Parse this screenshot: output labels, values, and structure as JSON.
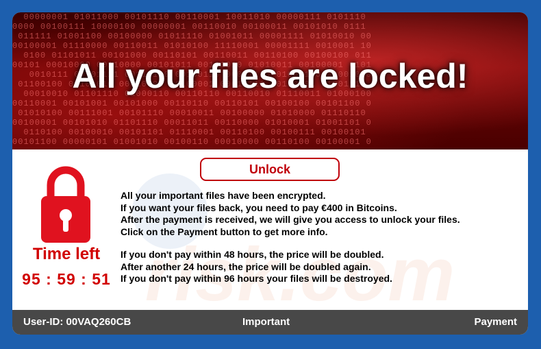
{
  "banner": {
    "title": "All your files are locked!",
    "background_binary": [
      "  00000001 01011000 00101110 00110001 10011010 00000111 0101110",
      "0000 00100111 10000100 00000001 00110010 00100011 00101010 0111",
      " 011111 01001100 00100000 01011110 01001011 00001111 01010010 00",
      "00100001 01110000 00110011 01010100 11110001 00001111 0010001 10",
      "  0100 01101011 00101000 00110101 00110011 00110100 00100100 011",
      "00101 00010000 00110000 00101011 00111010 01010011 00100001 0101",
      "   0010111 00101111 00110110 00100110 00001110 01001100 00001000",
      " 01100100 00101010 00010000 00100001 00010111 00110101 01001111 ",
      "  00010010 01101110 01000110 00110110 00110010 01110011 01000100",
      "00110001 00101001 00101000 00110110 00110101 00100100 00101100 0",
      " 01010100 00111001 00101110 00010011 00100000 01010000 01110110 ",
      "00100001 00101010 01101110 00011011 00110000 01010001 01001101 0",
      "  0110100 00100010 00101101 01110001 00110100 00100111 00100101 ",
      "00101100 00000101 01001010 00100110 00010000 00110100 00100001 0"
    ]
  },
  "watermark": {
    "text": "risk.com"
  },
  "lock_icon": {
    "name": "padlock-icon",
    "color": "#e0121f"
  },
  "timer": {
    "label": "Time left",
    "value": "95 : 59 : 51"
  },
  "unlock_button": {
    "label": "Unlock"
  },
  "message": {
    "lines": [
      "All your important files have been encrypted.",
      "If you want your files back, you need to pay €400 in Bitcoins.",
      "After the payment is received, we will give you access to unlock your files.",
      "Click on the Payment button to get more info.",
      "If you don't pay within 48 hours, the price will be doubled.",
      "After another 24 hours, the price will be doubled again.",
      "If you don't pay within 96 hours your files will be destroyed."
    ]
  },
  "footer": {
    "user_id": "User-ID: 00VAQ260CB",
    "important": "Important",
    "payment": "Payment"
  },
  "colors": {
    "frame": "#1d5fae",
    "accent_red": "#d10000",
    "footer_bg": "#484848"
  }
}
